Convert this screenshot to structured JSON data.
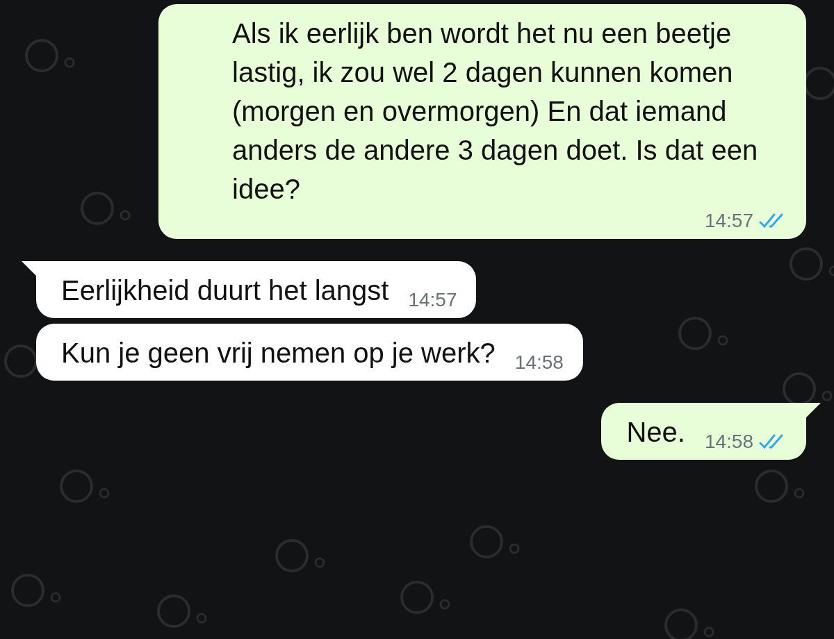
{
  "messages": [
    {
      "kind": "outgoing",
      "tail": false,
      "text": "Als ik eerlijk ben wordt het nu een beetje lastig, ik zou wel 2 dagen kunnen komen (morgen en overmorgen) En dat iemand anders de andere 3 dagen doet. Is dat een idee?",
      "time": "14:57",
      "read": true
    },
    {
      "kind": "incoming",
      "tail": true,
      "text": "Eerlijkheid duurt het langst",
      "time": "14:57"
    },
    {
      "kind": "incoming",
      "tail": false,
      "text": "Kun je geen vrij nemen op je werk?",
      "time": "14:58"
    },
    {
      "kind": "outgoing",
      "tail": true,
      "text": "Nee.",
      "time": "14:58",
      "read": true
    }
  ]
}
